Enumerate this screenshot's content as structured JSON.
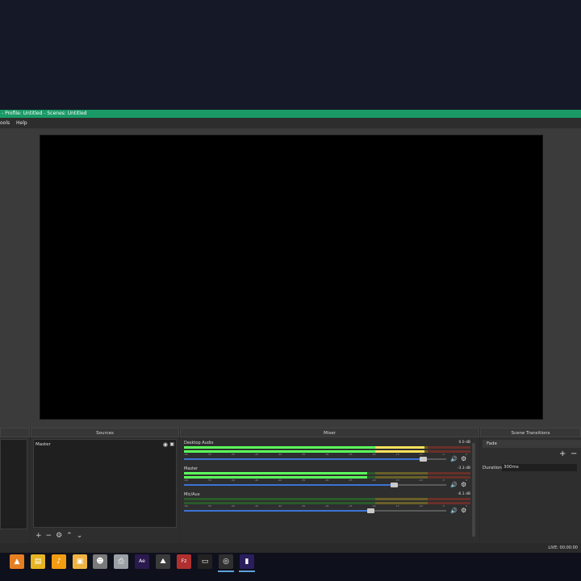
{
  "window": {
    "title": "- Profile: Untitled - Scenes: Untitled"
  },
  "menu": {
    "items": [
      "ools",
      "Help"
    ]
  },
  "docks": {
    "sources": "Sources",
    "mixer": "Mixer",
    "transitions": "Scene Transitions"
  },
  "sources": {
    "items": [
      {
        "label": "Master",
        "visible": true,
        "locked": true
      }
    ]
  },
  "mixer": {
    "tracks": [
      {
        "name": "Desktop Audio",
        "db": "0.0 dB",
        "level": 0.84,
        "volume": 0.91
      },
      {
        "name": "Master",
        "db": "-3.3 dB",
        "level": 0.64,
        "volume": 0.8
      },
      {
        "name": "Mic/Aux",
        "db": "-6.1 dB",
        "level": 0.0,
        "volume": 0.71
      }
    ],
    "scale_ticks": [
      "-60",
      "-55",
      "-50",
      "-45",
      "-40",
      "-35",
      "-30",
      "-25",
      "-20",
      "-15",
      "-10",
      "-5",
      "0"
    ]
  },
  "transitions": {
    "selected": "Fade",
    "duration_label": "Duration",
    "duration_value": "300ms"
  },
  "status": {
    "live": "LIVE: 00:00:00"
  },
  "taskbar": {
    "icons": [
      "vlc-icon",
      "file-explorer-icon",
      "fl-studio-icon",
      "folder-icon",
      "alien-icon",
      "printer-icon",
      "after-effects-icon",
      "photos-icon",
      "filezilla-icon",
      "terminal-icon",
      "obs-icon",
      "premiere-icon"
    ],
    "active": "obs-icon"
  },
  "colors": {
    "titlebar": "#1a9966",
    "meter_green": "#3fa33f",
    "meter_yellow": "#c8b43a",
    "meter_red": "#c84a3a",
    "slider_blue": "#3c74d6"
  }
}
